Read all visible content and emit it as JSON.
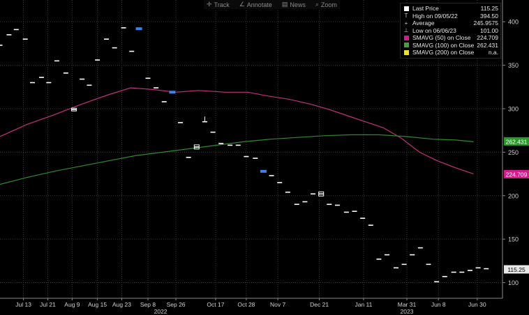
{
  "toolbar": {
    "items": [
      {
        "icon": "crosshair-icon",
        "glyph": "✛",
        "label": "Track"
      },
      {
        "icon": "pencil-icon",
        "glyph": "∠",
        "label": "Annotate"
      },
      {
        "icon": "news-icon",
        "glyph": "▤",
        "label": "News"
      },
      {
        "icon": "magnifier-icon",
        "glyph": "⌕",
        "label": "Zoom"
      }
    ]
  },
  "legend": {
    "rows": [
      {
        "symbol": "square",
        "color": "#ffffff",
        "label": "Last Price",
        "value": "115.25"
      },
      {
        "symbol": "T",
        "color": "#cfcfcf",
        "label": "High on 09/05/22",
        "value": "394.50"
      },
      {
        "symbol": "+",
        "color": "#cfcfcf",
        "label": "Average",
        "value": "245.9575"
      },
      {
        "symbol": "⊥",
        "color": "#cfcfcf",
        "label": "Low on 06/06/23",
        "value": "101.00"
      },
      {
        "symbol": "square",
        "color": "#d41a8c",
        "label": "SMAVG (50)  on Close",
        "value": "224.709"
      },
      {
        "symbol": "square",
        "color": "#3aa63a",
        "label": "SMAVG (100)  on Close",
        "value": "262.431"
      },
      {
        "symbol": "square",
        "color": "#f2e21b",
        "label": "SMAVG (200)  on Close",
        "value": "n.a."
      }
    ]
  },
  "colors": {
    "background": "#000000",
    "candle": "#ffffff",
    "candle_highlight": "#3b82f6",
    "sma50": "#c2307a",
    "sma100": "#2f8a2f",
    "grid": "#3a3a3a",
    "axis_text": "#cfcfcf"
  },
  "chart_data": {
    "type": "line",
    "grid": true,
    "y_axis_position": "right",
    "ylim": [
      82,
      425
    ],
    "y_ticks": [
      100,
      150,
      200,
      250,
      300,
      350,
      400
    ],
    "x_tick_labels": [
      "Jul 13",
      "Jul 21",
      "Aug 9",
      "Aug 15",
      "Aug 23",
      "Sep 8",
      "Sep 26",
      "Oct 17",
      "Oct 28",
      "Nov 7",
      "Dec 21",
      "Jan 11",
      "Mar 31",
      "Jun 8",
      "Jun 30"
    ],
    "x_tick_index": [
      2.6,
      5.3,
      8.0,
      10.8,
      13.5,
      16.4,
      19.5,
      23.9,
      27.3,
      30.8,
      35.4,
      40.3,
      45.1,
      48.6,
      52.9
    ],
    "x_year_labels": [
      {
        "label": "2022",
        "index": 17.8
      },
      {
        "label": "2023",
        "index": 45.1
      }
    ],
    "x_range": [
      0,
      55.7
    ],
    "price_series": {
      "name": "Last Price",
      "points": [
        {
          "i": 0.0,
          "close": 373
        },
        {
          "i": 1.0,
          "close": 385
        },
        {
          "i": 1.8,
          "close": 391
        },
        {
          "i": 2.8,
          "close": 380
        },
        {
          "i": 3.6,
          "close": 330
        },
        {
          "i": 4.6,
          "close": 336
        },
        {
          "i": 5.4,
          "close": 330
        },
        {
          "i": 6.3,
          "close": 355
        },
        {
          "i": 7.3,
          "close": 341
        },
        {
          "i": 8.2,
          "close": 299
        },
        {
          "i": 9.1,
          "close": 334
        },
        {
          "i": 9.9,
          "close": 327
        },
        {
          "i": 10.8,
          "close": 356
        },
        {
          "i": 11.8,
          "close": 380
        },
        {
          "i": 12.7,
          "close": 370
        },
        {
          "i": 13.7,
          "close": 393
        },
        {
          "i": 14.6,
          "close": 366
        },
        {
          "i": 15.4,
          "close": 392,
          "highlight": true
        },
        {
          "i": 16.4,
          "close": 335
        },
        {
          "i": 17.3,
          "close": 324
        },
        {
          "i": 18.2,
          "close": 308
        },
        {
          "i": 19.1,
          "close": 319,
          "highlight": true
        },
        {
          "i": 20.0,
          "close": 284
        },
        {
          "i": 20.9,
          "close": 244
        },
        {
          "i": 21.8,
          "close": 256
        },
        {
          "i": 22.7,
          "close": 285
        },
        {
          "i": 23.6,
          "close": 273
        },
        {
          "i": 24.5,
          "close": 260
        },
        {
          "i": 25.5,
          "close": 258
        },
        {
          "i": 26.4,
          "close": 258
        },
        {
          "i": 27.3,
          "close": 245
        },
        {
          "i": 28.3,
          "close": 243
        },
        {
          "i": 29.2,
          "close": 228,
          "highlight": true
        },
        {
          "i": 30.1,
          "close": 223
        },
        {
          "i": 31.0,
          "close": 215
        },
        {
          "i": 31.9,
          "close": 204
        },
        {
          "i": 32.9,
          "close": 190
        },
        {
          "i": 33.8,
          "close": 193
        },
        {
          "i": 34.7,
          "close": 202
        },
        {
          "i": 35.6,
          "close": 202
        },
        {
          "i": 36.5,
          "close": 190
        },
        {
          "i": 37.4,
          "close": 189
        },
        {
          "i": 38.4,
          "close": 181
        },
        {
          "i": 39.3,
          "close": 182
        },
        {
          "i": 40.2,
          "close": 174
        },
        {
          "i": 41.1,
          "close": 166
        },
        {
          "i": 42.0,
          "close": 127
        },
        {
          "i": 42.9,
          "close": 132
        },
        {
          "i": 43.9,
          "close": 117
        },
        {
          "i": 44.8,
          "close": 121
        },
        {
          "i": 45.7,
          "close": 132
        },
        {
          "i": 46.6,
          "close": 140
        },
        {
          "i": 47.5,
          "close": 121
        },
        {
          "i": 48.4,
          "close": 101
        },
        {
          "i": 49.3,
          "close": 107
        },
        {
          "i": 50.3,
          "close": 112
        },
        {
          "i": 51.2,
          "close": 112
        },
        {
          "i": 52.1,
          "close": 114
        },
        {
          "i": 53.0,
          "close": 117
        },
        {
          "i": 53.9,
          "close": 116
        }
      ]
    },
    "series": [
      {
        "name": "SMAVG (50)  on Close",
        "color": "#c2307a",
        "points": [
          [
            0,
            268
          ],
          [
            3,
            282
          ],
          [
            6,
            293
          ],
          [
            9,
            305
          ],
          [
            12,
            316
          ],
          [
            14.5,
            324
          ],
          [
            17,
            322
          ],
          [
            19.5,
            319
          ],
          [
            22,
            321
          ],
          [
            25,
            319
          ],
          [
            27.5,
            319
          ],
          [
            29.5,
            315
          ],
          [
            32,
            311
          ],
          [
            34.5,
            305
          ],
          [
            36.5,
            299
          ],
          [
            38.5,
            292
          ],
          [
            40.5,
            285
          ],
          [
            42.5,
            278
          ],
          [
            44.5,
            266
          ],
          [
            46.5,
            250
          ],
          [
            48.5,
            240
          ],
          [
            50.5,
            232
          ],
          [
            52.5,
            225
          ]
        ]
      },
      {
        "name": "SMAVG (100)  on Close",
        "color": "#2f8a2f",
        "points": [
          [
            0,
            213
          ],
          [
            3,
            221
          ],
          [
            6,
            228
          ],
          [
            9,
            234
          ],
          [
            12,
            240
          ],
          [
            15,
            246
          ],
          [
            18,
            250
          ],
          [
            21,
            254
          ],
          [
            24,
            258
          ],
          [
            27,
            262
          ],
          [
            30,
            265
          ],
          [
            33,
            267
          ],
          [
            36,
            269
          ],
          [
            39,
            270
          ],
          [
            42,
            270
          ],
          [
            45,
            268
          ],
          [
            48,
            265
          ],
          [
            50.5,
            264
          ],
          [
            52.5,
            262
          ]
        ]
      }
    ],
    "last_value_tags": [
      {
        "label": "262.431",
        "value": 262.431,
        "color": "#2a9b2a"
      },
      {
        "label": "224.709",
        "value": 224.709,
        "color": "#d41a8c"
      },
      {
        "label": "115.25",
        "value": 115.25,
        "color": "#e8e8e8"
      }
    ]
  }
}
